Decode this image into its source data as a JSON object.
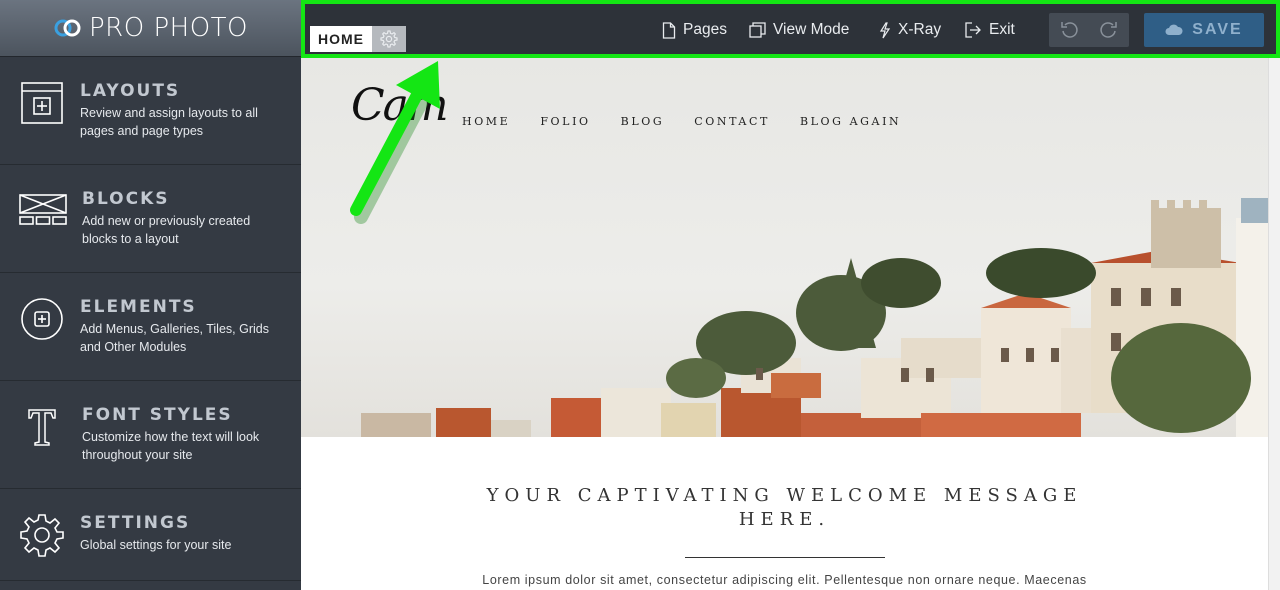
{
  "brand": {
    "name": "PRO PHOTO"
  },
  "sidebar": {
    "items": [
      {
        "title": "LAYOUTS",
        "desc": "Review and assign layouts to all pages and page types",
        "icon": "layout-plus-icon"
      },
      {
        "title": "BLOCKS",
        "desc": "Add new or previously created blocks to a layout",
        "icon": "blocks-icon"
      },
      {
        "title": "ELEMENTS",
        "desc": "Add Menus, Galleries, Tiles, Grids and Other Modules",
        "icon": "circle-plus-icon"
      },
      {
        "title": "FONT STYLES",
        "desc": "Customize how the text will look throughout your site",
        "icon": "font-t-icon"
      },
      {
        "title": "SETTINGS",
        "desc": "Global settings for your site",
        "icon": "gear-icon"
      }
    ]
  },
  "toolbar": {
    "current_page": "HOME",
    "pages_label": "Pages",
    "view_mode_label": "View Mode",
    "xray_label": "X-Ray",
    "exit_label": "Exit",
    "save_label": "SAVE"
  },
  "site": {
    "logo_text": "Cam",
    "nav": [
      "HOME",
      "FOLIO",
      "BLOG",
      "CONTACT",
      "BLOG AGAIN"
    ],
    "welcome": "YOUR CAPTIVATING WELCOME MESSAGE HERE.",
    "lorem": "Lorem ipsum dolor sit amet, consectetur adipiscing elit. Pellentesque non ornare neque. Maecenas"
  },
  "colors": {
    "highlight": "#14e614",
    "sidebar_bg": "#343a43",
    "toolbar_bg": "#2d3239",
    "save_bg": "#2f5e86"
  }
}
